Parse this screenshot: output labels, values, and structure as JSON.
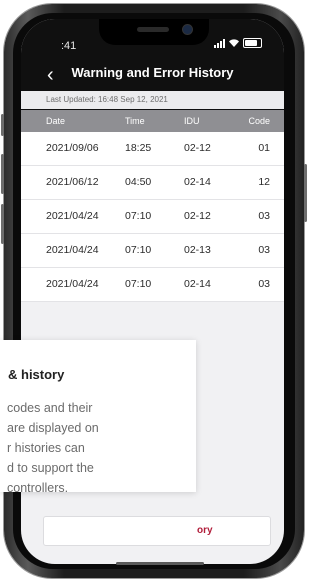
{
  "status": {
    "time": ":41"
  },
  "header": {
    "title": "Warning and Error History",
    "back_glyph": "‹"
  },
  "last_updated": "Last Updated: 16:48 Sep 12, 2021",
  "table": {
    "columns": [
      "Date",
      "Time",
      "IDU",
      "Code"
    ],
    "rows": [
      [
        "2021/09/06",
        "18:25",
        "02-12",
        "01"
      ],
      [
        "2021/06/12",
        "04:50",
        "02-14",
        "12"
      ],
      [
        "2021/04/24",
        "07:10",
        "02-12",
        "03"
      ],
      [
        "2021/04/24",
        "07:10",
        "02-13",
        "03"
      ],
      [
        "2021/04/24",
        "07:10",
        "02-14",
        "03"
      ]
    ]
  },
  "bottom_button": {
    "label": "ory"
  },
  "card": {
    "title": "& history",
    "lines": [
      "codes and their",
      "are displayed on",
      "r histories can",
      "d to support the",
      "controllers."
    ]
  },
  "colors": {
    "accent": "#b11d3a",
    "header_bg": "#101010",
    "table_header_bg": "#8f8f93"
  }
}
